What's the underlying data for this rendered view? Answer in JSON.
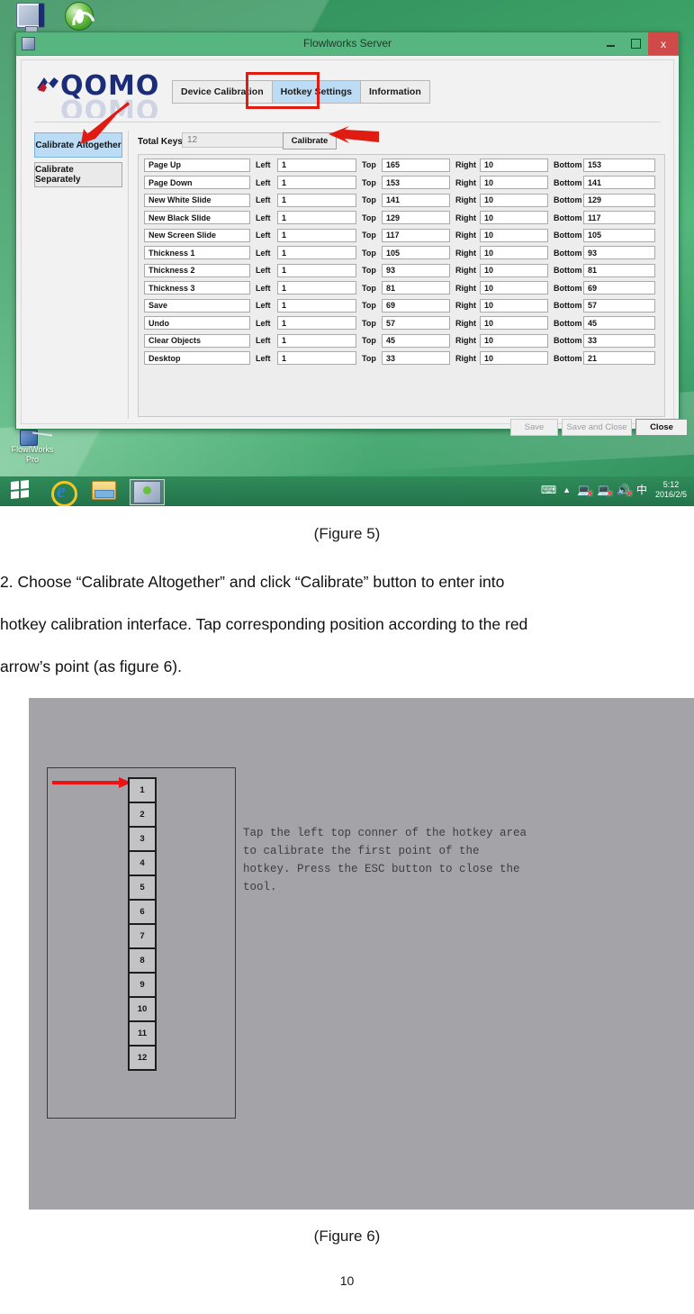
{
  "document": {
    "page_number": "10",
    "figure5_caption": "(Figure 5)",
    "figure6_caption": "(Figure 6)",
    "paragraph2": {
      "line1": "2.  Choose “Calibrate Altogether” and click “Calibrate” button to enter into",
      "line2": "hotkey calibration interface. Tap corresponding position according to the red",
      "line3": "arrow’s point (as figure 6)."
    }
  },
  "desktop": {
    "icons": [
      {
        "name": "computer-icon",
        "label": ""
      },
      {
        "name": "browser-icon",
        "label": ""
      }
    ],
    "flowworks_shortcut_label_line1": "FlowIWorks",
    "flowworks_shortcut_label_line2": "Pro",
    "taskbar": {
      "start_label": "Start",
      "items": [
        "windows-start",
        "internet-explorer",
        "file-explorer",
        "flowworks-server"
      ],
      "tray_ime": "中",
      "clock_time": "5:12",
      "clock_date": "2016/2/5"
    }
  },
  "app_window": {
    "title": "Flowlworks Server",
    "window_buttons": {
      "minimize": "–",
      "maximize": "□",
      "close": "x"
    },
    "logo_text": "QOMO",
    "tabs": [
      {
        "id": "device-calibration",
        "label": "Device Calibration",
        "active": false
      },
      {
        "id": "hotkey-settings",
        "label": "Hotkey Settings",
        "active": true
      },
      {
        "id": "information",
        "label": "Information",
        "active": false
      }
    ],
    "side_buttons": [
      {
        "id": "calibrate-altogether",
        "label": "Calibrate Altogether",
        "selected": true
      },
      {
        "id": "calibrate-separately",
        "label": "Calibrate Separately",
        "selected": false
      }
    ],
    "total_keys_label": "Total Keys:",
    "total_keys_value": "12",
    "calibrate_button_label": "Calibrate",
    "column_labels": {
      "left": "Left",
      "top": "Top",
      "right": "Right",
      "bottom": "Bottom"
    },
    "rows": [
      {
        "name": "Page Up",
        "left": "1",
        "top": "165",
        "right": "10",
        "bottom": "153"
      },
      {
        "name": "Page Down",
        "left": "1",
        "top": "153",
        "right": "10",
        "bottom": "141"
      },
      {
        "name": "New White Slide",
        "left": "1",
        "top": "141",
        "right": "10",
        "bottom": "129"
      },
      {
        "name": "New Black Slide",
        "left": "1",
        "top": "129",
        "right": "10",
        "bottom": "117"
      },
      {
        "name": "New Screen Slide",
        "left": "1",
        "top": "117",
        "right": "10",
        "bottom": "105"
      },
      {
        "name": "Thickness 1",
        "left": "1",
        "top": "105",
        "right": "10",
        "bottom": "93"
      },
      {
        "name": "Thickness 2",
        "left": "1",
        "top": "93",
        "right": "10",
        "bottom": "81"
      },
      {
        "name": "Thickness 3",
        "left": "1",
        "top": "81",
        "right": "10",
        "bottom": "69"
      },
      {
        "name": "Save",
        "left": "1",
        "top": "69",
        "right": "10",
        "bottom": "57"
      },
      {
        "name": "Undo",
        "left": "1",
        "top": "57",
        "right": "10",
        "bottom": "45"
      },
      {
        "name": "Clear Objects",
        "left": "1",
        "top": "45",
        "right": "10",
        "bottom": "33"
      },
      {
        "name": "Desktop",
        "left": "1",
        "top": "33",
        "right": "10",
        "bottom": "21"
      }
    ],
    "footer_buttons": [
      {
        "id": "save",
        "label": "Save",
        "enabled": false
      },
      {
        "id": "save-and-close",
        "label": "Save and Close",
        "enabled": false
      },
      {
        "id": "close",
        "label": "Close",
        "enabled": true
      }
    ]
  },
  "calibration_screen": {
    "instruction": "Tap the left top conner of the hotkey area\nto calibrate the first point of the\nhotkey. Press the ESC button to close the\ntool.",
    "keys": [
      "1",
      "2",
      "3",
      "4",
      "5",
      "6",
      "7",
      "8",
      "9",
      "10",
      "11",
      "12"
    ]
  },
  "colors": {
    "accent_green": "#2e8b57",
    "titlebar_green": "#57b57f",
    "tab_active_blue": "#bcdcf5",
    "highlight_red": "#e01b12",
    "close_button_red": "#d04a4a",
    "logo_navy": "#1b2d78",
    "figure6_background": "#a3a3a8"
  }
}
